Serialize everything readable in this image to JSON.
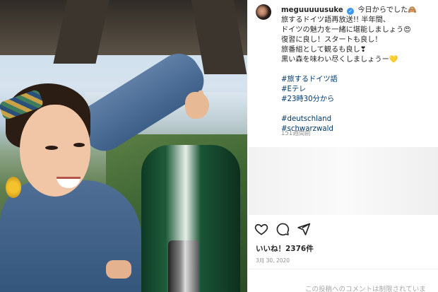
{
  "post": {
    "username": "meguuuuusuke",
    "caption_lines": [
      "今日からでした🙈",
      "旅するドイツ語再放送!! 半年間、",
      "ドイツの魅力を一緒に堪能しましょう😍",
      "復習に良し！スタートも良し！",
      "旅番組として観るも良し❣",
      "黒い森を味わい尽くしましょうー💛"
    ],
    "hashtags_group1": [
      "#旅するドイツ語",
      "#Eテレ",
      "#23時30分から"
    ],
    "hashtags_group2": [
      "#deutschland",
      "#schwarzwald"
    ],
    "time_ago": "151週間前",
    "likes": "いいね！2376件",
    "date": "3月 30, 2020",
    "comments_disabled": "この投稿へのコメントは制限されていま"
  },
  "icons": {
    "verified": "verified-badge-icon",
    "like": "heart-icon",
    "comment": "comment-icon",
    "share": "share-icon"
  },
  "colors": {
    "link": "#00376b",
    "verified": "#3897f0",
    "muted": "#8e8e8e"
  }
}
